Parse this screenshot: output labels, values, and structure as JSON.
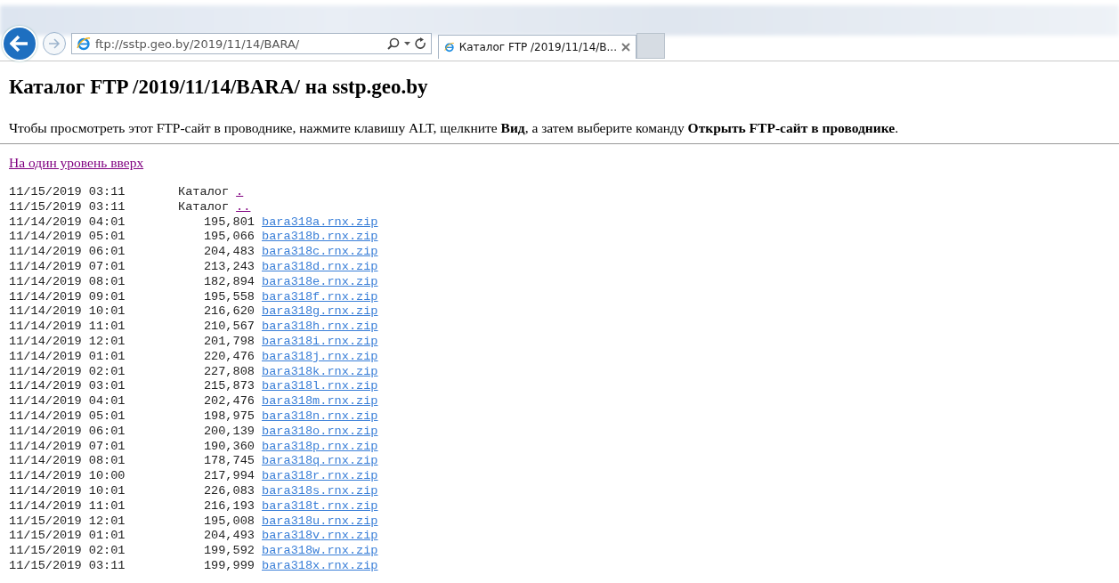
{
  "browser": {
    "address": "ftp://sstp.geo.by/2019/11/14/BARA/",
    "tabs": [
      {
        "title": "Каталог FTP /2019/11/14/B...",
        "selected": true
      }
    ]
  },
  "page": {
    "heading": "Каталог FTP /2019/11/14/BARA/ на sstp.geo.by",
    "hint": "Чтобы просмотреть этот FTP-сайт в проводнике, нажмите клавишу ALT, щелкните **Вид**, а затем выберите команду **Открыть FTP-сайт в проводнике**.",
    "up_link": {
      "label": "На один уровень вверх",
      "visited": true
    }
  },
  "listing": [
    {
      "kind": "dir",
      "date": "11/15/2019 03:11",
      "type": "Каталог",
      "name": ".",
      "visited": true
    },
    {
      "kind": "dir",
      "date": "11/15/2019 03:11",
      "type": "Каталог",
      "name": "..",
      "visited": true
    },
    {
      "kind": "file",
      "date": "11/14/2019 04:01",
      "size": "195,801",
      "name": "bara318a.rnx.zip",
      "visited": false
    },
    {
      "kind": "file",
      "date": "11/14/2019 05:01",
      "size": "195,066",
      "name": "bara318b.rnx.zip",
      "visited": false
    },
    {
      "kind": "file",
      "date": "11/14/2019 06:01",
      "size": "204,483",
      "name": "bara318c.rnx.zip",
      "visited": false
    },
    {
      "kind": "file",
      "date": "11/14/2019 07:01",
      "size": "213,243",
      "name": "bara318d.rnx.zip",
      "visited": false
    },
    {
      "kind": "file",
      "date": "11/14/2019 08:01",
      "size": "182,894",
      "name": "bara318e.rnx.zip",
      "visited": false
    },
    {
      "kind": "file",
      "date": "11/14/2019 09:01",
      "size": "195,558",
      "name": "bara318f.rnx.zip",
      "visited": false
    },
    {
      "kind": "file",
      "date": "11/14/2019 10:01",
      "size": "216,620",
      "name": "bara318g.rnx.zip",
      "visited": false
    },
    {
      "kind": "file",
      "date": "11/14/2019 11:01",
      "size": "210,567",
      "name": "bara318h.rnx.zip",
      "visited": false
    },
    {
      "kind": "file",
      "date": "11/14/2019 12:01",
      "size": "201,798",
      "name": "bara318i.rnx.zip",
      "visited": false
    },
    {
      "kind": "file",
      "date": "11/14/2019 01:01",
      "size": "220,476",
      "name": "bara318j.rnx.zip",
      "visited": false
    },
    {
      "kind": "file",
      "date": "11/14/2019 02:01",
      "size": "227,808",
      "name": "bara318k.rnx.zip",
      "visited": false
    },
    {
      "kind": "file",
      "date": "11/14/2019 03:01",
      "size": "215,873",
      "name": "bara318l.rnx.zip",
      "visited": false
    },
    {
      "kind": "file",
      "date": "11/14/2019 04:01",
      "size": "202,476",
      "name": "bara318m.rnx.zip",
      "visited": false
    },
    {
      "kind": "file",
      "date": "11/14/2019 05:01",
      "size": "198,975",
      "name": "bara318n.rnx.zip",
      "visited": false
    },
    {
      "kind": "file",
      "date": "11/14/2019 06:01",
      "size": "200,139",
      "name": "bara318o.rnx.zip",
      "visited": false
    },
    {
      "kind": "file",
      "date": "11/14/2019 07:01",
      "size": "190,360",
      "name": "bara318p.rnx.zip",
      "visited": false
    },
    {
      "kind": "file",
      "date": "11/14/2019 08:01",
      "size": "178,745",
      "name": "bara318q.rnx.zip",
      "visited": false
    },
    {
      "kind": "file",
      "date": "11/14/2019 10:00",
      "size": "217,994",
      "name": "bara318r.rnx.zip",
      "visited": false
    },
    {
      "kind": "file",
      "date": "11/14/2019 10:01",
      "size": "226,083",
      "name": "bara318s.rnx.zip",
      "visited": false
    },
    {
      "kind": "file",
      "date": "11/14/2019 11:01",
      "size": "216,193",
      "name": "bara318t.rnx.zip",
      "visited": false
    },
    {
      "kind": "file",
      "date": "11/15/2019 12:01",
      "size": "195,008",
      "name": "bara318u.rnx.zip",
      "visited": false
    },
    {
      "kind": "file",
      "date": "11/15/2019 01:01",
      "size": "204,493",
      "name": "bara318v.rnx.zip",
      "visited": false
    },
    {
      "kind": "file",
      "date": "11/15/2019 02:01",
      "size": "199,592",
      "name": "bara318w.rnx.zip",
      "visited": false
    },
    {
      "kind": "file",
      "date": "11/15/2019 03:11",
      "size": "199,999",
      "name": "bara318x.rnx.zip",
      "visited": false
    }
  ]
}
